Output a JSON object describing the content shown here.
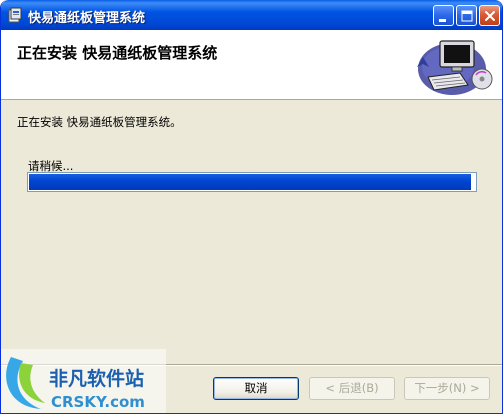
{
  "window": {
    "title": "快易通纸板管理系统"
  },
  "header": {
    "title": "正在安装  快易通纸板管理系统"
  },
  "body": {
    "status_text": "正在安装 快易通纸板管理系统。",
    "wait_text": "请稍候...",
    "progress_fraction": 0.99
  },
  "buttons": {
    "cancel": "取消",
    "back": "< 后退(B)",
    "next": "下一步(N) >"
  },
  "watermark": {
    "cn_text": "非凡软件站",
    "en_text": "CRSKY.com"
  },
  "colors": {
    "titlebar": "#0054e3",
    "progress_fill": "#0047d4",
    "dialog_bg": "#ece9d8"
  }
}
